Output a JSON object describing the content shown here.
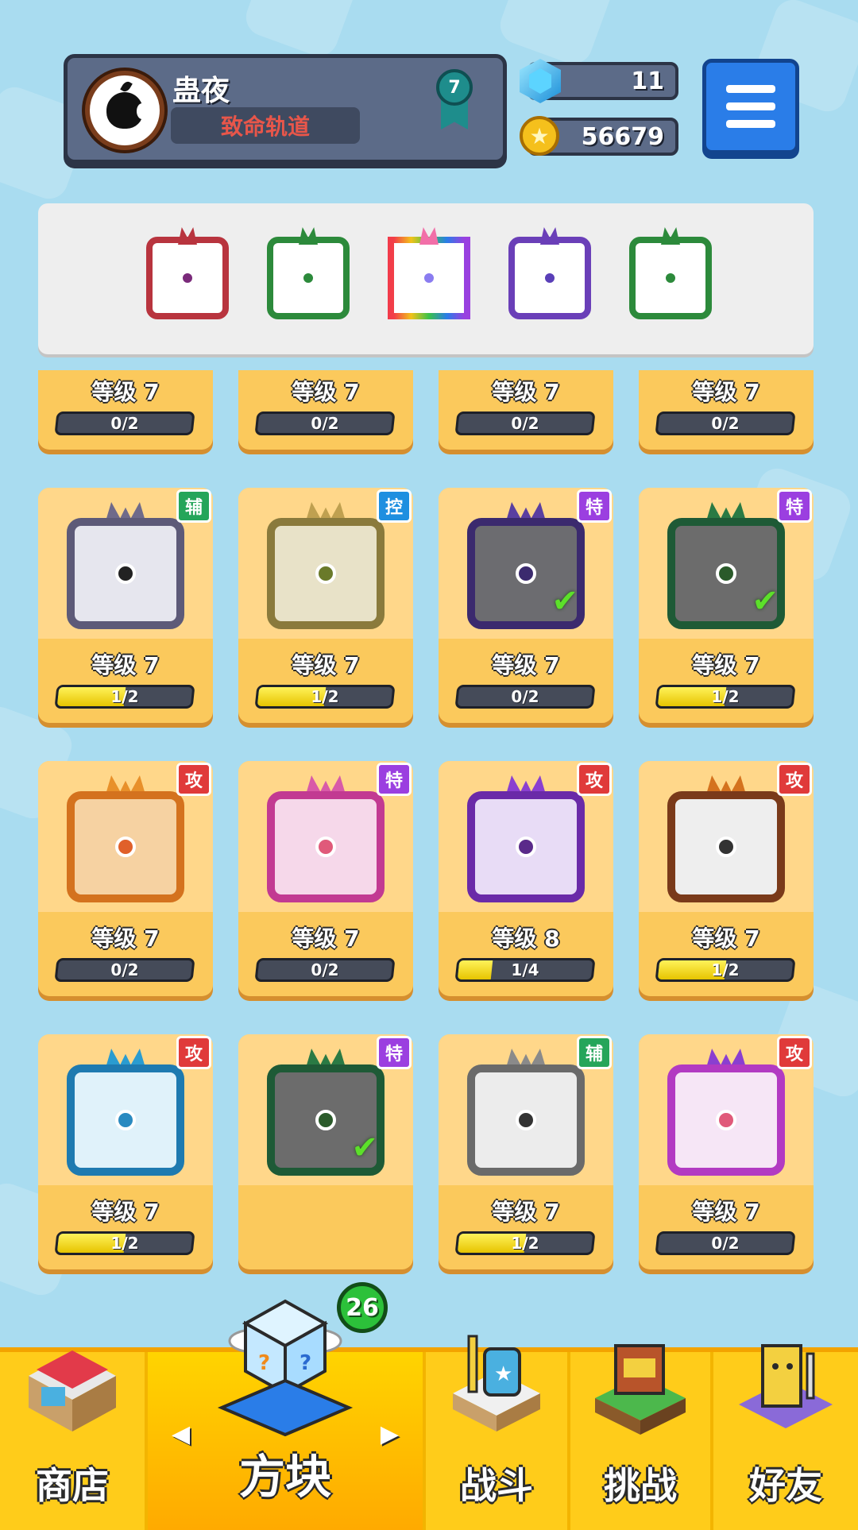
{
  "profile": {
    "player_name": "蛊夜",
    "title": "致命轨道",
    "rank_level": "7"
  },
  "currency": {
    "gems": "11",
    "coins": "56679"
  },
  "loadout": [
    {
      "name": "saw-dice",
      "color": "#b8343e",
      "dot": "#7a2a7a"
    },
    {
      "name": "poison-dice",
      "color": "#2c8a3b",
      "dot": "#2c8a3b"
    },
    {
      "name": "mimic-dice",
      "color": "#f26fa8",
      "dot": "#8a7cf0"
    },
    {
      "name": "gravity-dice",
      "color": "#6a3fb8",
      "dot": "#5a3fb8"
    },
    {
      "name": "hex-dice",
      "color": "#2c8a3b",
      "dot": "#2c8a3b"
    }
  ],
  "cards": [
    {
      "row": 0,
      "col": 0,
      "level": "等级 7",
      "progress": "0/2",
      "fill": 0,
      "frame": "#9b2030",
      "horn": "#7a3fb8",
      "dot": "#e07a3a",
      "face": "#f6dada",
      "tag": "",
      "tag_color": ""
    },
    {
      "row": 0,
      "col": 1,
      "level": "等级 7",
      "progress": "0/2",
      "fill": 0,
      "frame": "#5a2d8c",
      "horn": "#7a3fb8",
      "dot": "#5a2d8c",
      "face": "#e2d6f3",
      "tag": "",
      "tag_color": ""
    },
    {
      "row": 0,
      "col": 2,
      "level": "等级 7",
      "progress": "0/2",
      "fill": 0,
      "frame": "#7a4a22",
      "horn": "#b8732e",
      "dot": "#e09a46",
      "face": "#efe6da",
      "tag": "",
      "tag_color": ""
    },
    {
      "row": 0,
      "col": 3,
      "level": "等级 7",
      "progress": "0/2",
      "fill": 0,
      "frame": "#1e6e8a",
      "horn": "#2a9cc4",
      "dot": "#3cc0d6",
      "face": "#d4f0f6",
      "tag": "",
      "tag_color": ""
    },
    {
      "row": 1,
      "col": 0,
      "level": "等级 7",
      "progress": "1/2",
      "fill": 0.5,
      "frame": "#5d5a78",
      "horn": "#6f6a8a",
      "dot": "#222222",
      "face": "#e6e6ee",
      "tag": "辅",
      "tag_color": "#25a55a",
      "checked": false
    },
    {
      "row": 1,
      "col": 1,
      "level": "等级 7",
      "progress": "1/2",
      "fill": 0.5,
      "frame": "#8a7a3c",
      "horn": "#bfa050",
      "dot": "#6a7a2a",
      "face": "#e8e2c8",
      "tag": "控",
      "tag_color": "#1e8fe0",
      "checked": false
    },
    {
      "row": 1,
      "col": 2,
      "level": "等级 7",
      "progress": "0/2",
      "fill": 0,
      "frame": "#3b2a6e",
      "horn": "#5a3fa0",
      "dot": "#3b2a6e",
      "face": "#6c6c70",
      "tag": "特",
      "tag_color": "#9b3fe0",
      "checked": true
    },
    {
      "row": 1,
      "col": 3,
      "level": "等级 7",
      "progress": "1/2",
      "fill": 0.5,
      "frame": "#1e5a36",
      "horn": "#2a7a44",
      "dot": "#2a5a2a",
      "face": "#6c6c6c",
      "tag": "特",
      "tag_color": "#9b3fe0",
      "checked": true
    },
    {
      "row": 2,
      "col": 0,
      "level": "等级 7",
      "progress": "0/2",
      "fill": 0,
      "frame": "#d4721e",
      "horn": "#e8902a",
      "dot": "#e0602a",
      "face": "#f6d2a2",
      "tag": "攻",
      "tag_color": "#e03a3a",
      "checked": false
    },
    {
      "row": 2,
      "col": 1,
      "level": "等级 7",
      "progress": "0/2",
      "fill": 0,
      "frame": "#c23a92",
      "horn": "#d85aa8",
      "dot": "#e05a7a",
      "face": "#f6d8ea",
      "tag": "特",
      "tag_color": "#9b3fe0",
      "checked": false
    },
    {
      "row": 2,
      "col": 2,
      "level": "等级 8",
      "progress": "1/4",
      "fill": 0.25,
      "frame": "#6a2aa8",
      "horn": "#8a3fd0",
      "dot": "#5a2a8a",
      "face": "#e8dcf6",
      "tag": "攻",
      "tag_color": "#e03a3a",
      "checked": false
    },
    {
      "row": 2,
      "col": 3,
      "level": "等级 7",
      "progress": "1/2",
      "fill": 0.5,
      "frame": "#7a3a1a",
      "horn": "#d4721e",
      "dot": "#333333",
      "face": "#eeeeee",
      "tag": "攻",
      "tag_color": "#e03a3a",
      "checked": false
    },
    {
      "row": 3,
      "col": 0,
      "level": "等级 7",
      "progress": "1/2",
      "fill": 0.5,
      "frame": "#1e7ab0",
      "horn": "#2a9cd0",
      "dot": "#2a8ac0",
      "face": "#e0f2fa",
      "tag": "攻",
      "tag_color": "#e03a3a",
      "checked": false
    },
    {
      "row": 3,
      "col": 1,
      "level": "",
      "progress": "",
      "fill": 0,
      "frame": "#1e5a36",
      "horn": "#2a7a44",
      "dot": "#2a5a2a",
      "face": "#6c6c6c",
      "tag": "特",
      "tag_color": "#9b3fe0",
      "checked": true
    },
    {
      "row": 3,
      "col": 2,
      "level": "等级 7",
      "progress": "1/2",
      "fill": 0.5,
      "frame": "#6a6a6a",
      "horn": "#8a8a8a",
      "dot": "#333333",
      "face": "#ececec",
      "tag": "辅",
      "tag_color": "#25a55a",
      "checked": false
    },
    {
      "row": 3,
      "col": 3,
      "level": "等级 7",
      "progress": "0/2",
      "fill": 0,
      "frame": "#b23ac2",
      "horn": "#8a3fd0",
      "dot": "#e05a7a",
      "face": "#f6e6f6",
      "tag": "攻",
      "tag_color": "#e03a3a",
      "checked": false
    }
  ],
  "nav": {
    "shop": "商店",
    "dice": "方块",
    "battle": "战斗",
    "challenge": "挑战",
    "friends": "好友",
    "dice_count": "26",
    "prev_arrow": "◀",
    "next_arrow": "▶"
  }
}
